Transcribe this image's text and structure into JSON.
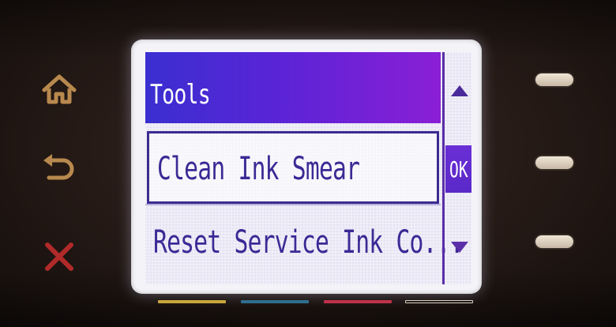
{
  "screen": {
    "title": "Tools",
    "menu_items": [
      {
        "label": "Clean Ink Smear",
        "selected": true
      },
      {
        "label": "Reset Service Ink Co...",
        "selected": false
      }
    ],
    "ok_label": "OK"
  },
  "hardware_buttons": {
    "left": [
      "home-icon",
      "back-icon",
      "cancel-icon"
    ],
    "right_count": 3
  },
  "ink_strip_colors": [
    "#c9a63a",
    "#2f6f8f",
    "#c0324a",
    "#d8d0c0"
  ],
  "colors": {
    "title_bar_start": "#3a2fd0",
    "title_bar_end": "#8a1fd6",
    "menu_text": "#3a2a95",
    "cancel_icon": "#b02a2a",
    "home_icon": "#b8894e"
  }
}
